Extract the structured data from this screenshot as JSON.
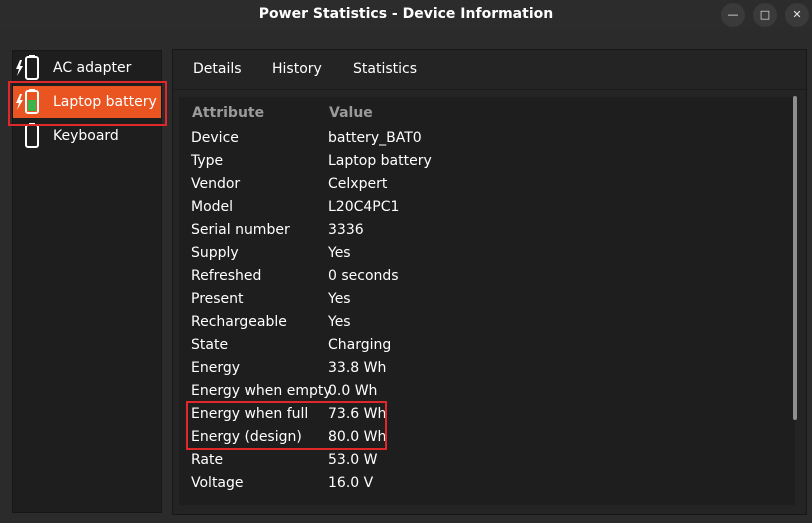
{
  "window": {
    "title": "Power Statistics - Device Information",
    "min_icon": "minimize-icon",
    "max_icon": "maximize-icon",
    "close_icon": "close-icon"
  },
  "sidebar": {
    "items": [
      {
        "label": "AC adapter",
        "icon": "ac-adapter-icon"
      },
      {
        "label": "Laptop battery",
        "icon": "battery-charging-icon",
        "selected": true
      },
      {
        "label": "Keyboard",
        "icon": "keyboard-battery-icon"
      }
    ]
  },
  "tabs": [
    {
      "label": "Details",
      "active": true
    },
    {
      "label": "History"
    },
    {
      "label": "Statistics"
    }
  ],
  "table": {
    "headers": {
      "attribute": "Attribute",
      "value": "Value"
    },
    "rows": [
      {
        "attribute": "Device",
        "value": "battery_BAT0"
      },
      {
        "attribute": "Type",
        "value": "Laptop battery"
      },
      {
        "attribute": "Vendor",
        "value": "Celxpert"
      },
      {
        "attribute": "Model",
        "value": "L20C4PC1"
      },
      {
        "attribute": "Serial number",
        "value": "3336"
      },
      {
        "attribute": "Supply",
        "value": "Yes"
      },
      {
        "attribute": "Refreshed",
        "value": "0 seconds"
      },
      {
        "attribute": "Present",
        "value": "Yes"
      },
      {
        "attribute": "Rechargeable",
        "value": "Yes"
      },
      {
        "attribute": "State",
        "value": "Charging"
      },
      {
        "attribute": "Energy",
        "value": "33.8 Wh"
      },
      {
        "attribute": "Energy when empty",
        "value": "0.0 Wh"
      },
      {
        "attribute": "Energy when full",
        "value": "73.6 Wh"
      },
      {
        "attribute": "Energy (design)",
        "value": "80.0 Wh"
      },
      {
        "attribute": "Rate",
        "value": "53.0 W"
      },
      {
        "attribute": "Voltage",
        "value": "16.0 V"
      }
    ]
  },
  "colors": {
    "accent": "#e95420",
    "highlight_box": "#e0272a",
    "battery_fill": "#3cb44b"
  }
}
